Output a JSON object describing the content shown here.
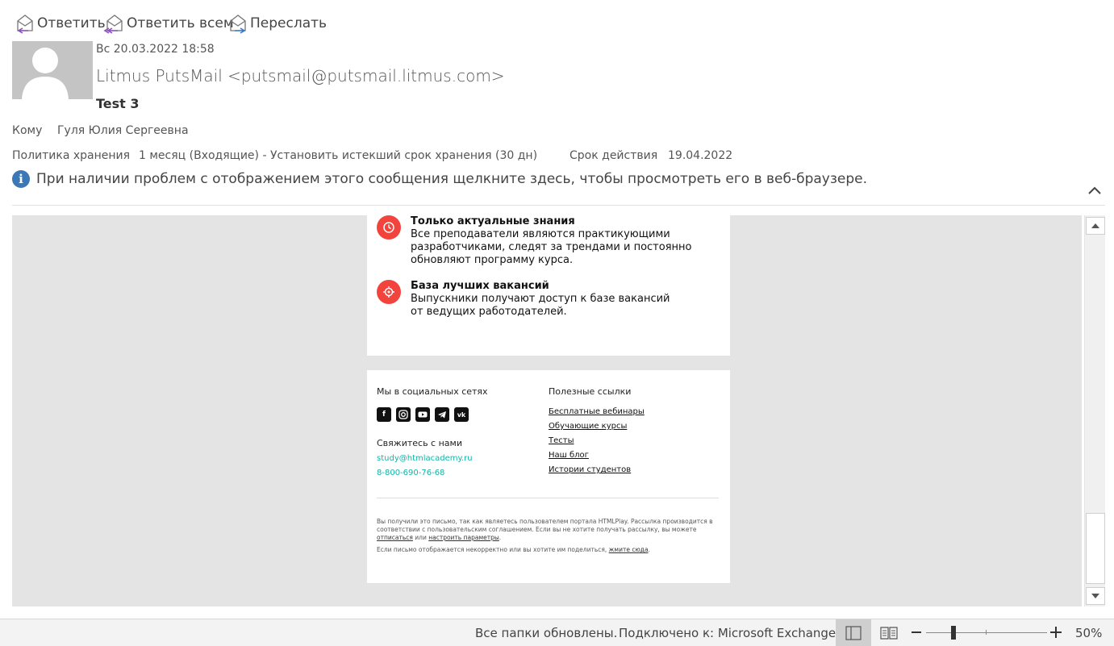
{
  "toolbar": {
    "reply": "Ответить",
    "reply_all": "Ответить всем",
    "forward": "Переслать"
  },
  "message": {
    "date": "Вс 20.03.2022 18:58",
    "sender": "Litmus PutsMail <putsmail@putsmail.litmus.com>",
    "subject": "Test 3",
    "to_label": "Кому",
    "to_value": "Гуля Юлия Сергеевна",
    "retention_label": "Политика хранения",
    "retention_value": "1 месяц (Входящие) - Установить истекший срок хранения (30 дн)",
    "expiry_label": "Срок действия",
    "expiry_value": "19.04.2022",
    "info_text": "При наличии проблем с отображением этого сообщения щелкните здесь, чтобы просмотреть его в веб-браузере."
  },
  "email_body": {
    "features": [
      {
        "icon": "clock-icon",
        "title": "Только актуальные знания",
        "lines": [
          "Все преподаватели являются практикующими",
          "разработчиками, следят за трендами и постоянно",
          "обновляют программу курса."
        ]
      },
      {
        "icon": "target-icon",
        "title": "База лучших вакансий",
        "lines": [
          "Выпускники получают доступ к базе вакансий",
          "от ведущих работодателей."
        ]
      }
    ],
    "footer": {
      "social_heading": "Мы в социальных сетях",
      "social_icons": [
        "facebook-icon",
        "instagram-icon",
        "youtube-icon",
        "telegram-icon",
        "vk-icon"
      ],
      "contact_heading": "Свяжитесь с нами",
      "email": "study@htmlacademy.ru",
      "phone": "8-800-690-76-68",
      "links_heading": "Полезные ссылки",
      "links": [
        "Бесплатные вебинары",
        "Обучающие курсы",
        "Тесты",
        "Наш блог",
        "Истории студентов"
      ],
      "legal_1": "Вы получили это письмо, так как являетесь пользователем портала HTMLPlay. Рассылка производится в соответствии с пользовательским соглашением. Если вы не хотите получать рассылку, вы можете",
      "unsubscribe": "отписаться",
      "or": "или",
      "configure": "настроить параметры",
      "legal_2": "Если письмо отображается некорректно или вы хотите им поделиться,",
      "click_here": "жмите сюда"
    }
  },
  "status_bar": {
    "folders": "Все папки обновлены.",
    "connection": "Подключено к: Microsoft Exchange",
    "zoom": "50%"
  },
  "colors": {
    "accent_red": "#f2443d",
    "link_teal": "#12b5a5",
    "info_blue": "#3c78b5"
  }
}
